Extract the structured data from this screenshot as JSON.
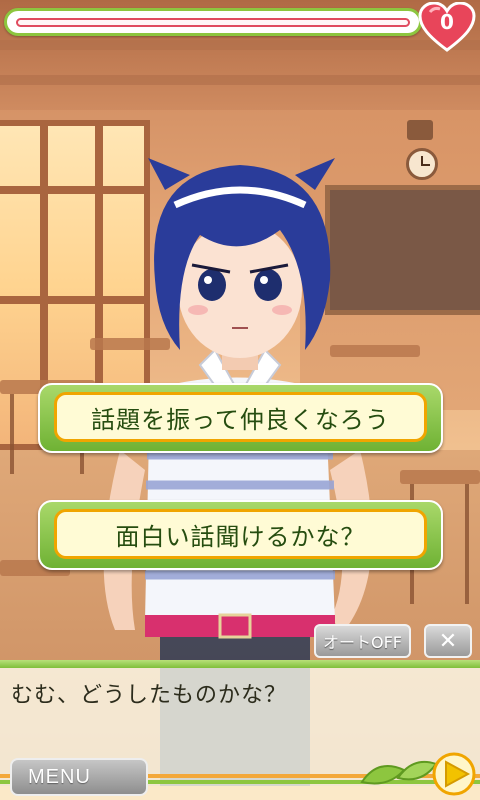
{
  "status": {
    "affection_count": "0",
    "affection_level": 0
  },
  "choices": [
    {
      "label": "話題を振って仲良くなろう"
    },
    {
      "label": "面白い話聞けるかな？"
    }
  ],
  "controls": {
    "auto_label": "オートOFF",
    "close_label": "✕",
    "menu_label": "MENU"
  },
  "dialogue": {
    "text": "むむ、どうしたものかな？"
  },
  "icons": {
    "affection": "heart-icon",
    "next": "play-arrow-icon",
    "close": "close-icon"
  },
  "colors": {
    "accent_green": "#8dc63f",
    "heart_red": "#e8455a",
    "button_cream": "#fffbd5",
    "button_border": "#f0a500"
  }
}
